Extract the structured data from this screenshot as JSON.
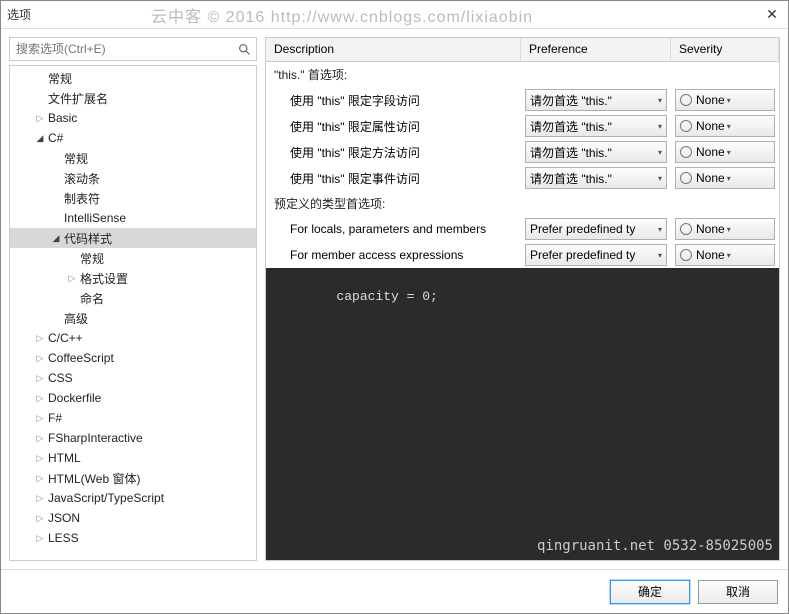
{
  "window": {
    "title": "选项"
  },
  "watermark_top": "云中客 © 2016 http://www.cnblogs.com/lixiaobin",
  "search": {
    "placeholder": "搜索选项(Ctrl+E)"
  },
  "tree": [
    {
      "label": "常规",
      "depth": 1,
      "exp": "none"
    },
    {
      "label": "文件扩展名",
      "depth": 1,
      "exp": "none"
    },
    {
      "label": "Basic",
      "depth": 1,
      "exp": "closed"
    },
    {
      "label": "C#",
      "depth": 1,
      "exp": "open"
    },
    {
      "label": "常规",
      "depth": 2,
      "exp": "none"
    },
    {
      "label": "滚动条",
      "depth": 2,
      "exp": "none"
    },
    {
      "label": "制表符",
      "depth": 2,
      "exp": "none"
    },
    {
      "label": "IntelliSense",
      "depth": 2,
      "exp": "none"
    },
    {
      "label": "代码样式",
      "depth": 2,
      "exp": "open",
      "selected": true
    },
    {
      "label": "常规",
      "depth": 3,
      "exp": "none"
    },
    {
      "label": "格式设置",
      "depth": 3,
      "exp": "closed"
    },
    {
      "label": "命名",
      "depth": 3,
      "exp": "none"
    },
    {
      "label": "高级",
      "depth": 2,
      "exp": "none"
    },
    {
      "label": "C/C++",
      "depth": 1,
      "exp": "closed"
    },
    {
      "label": "CoffeeScript",
      "depth": 1,
      "exp": "closed"
    },
    {
      "label": "CSS",
      "depth": 1,
      "exp": "closed"
    },
    {
      "label": "Dockerfile",
      "depth": 1,
      "exp": "closed"
    },
    {
      "label": "F#",
      "depth": 1,
      "exp": "closed"
    },
    {
      "label": "FSharpInteractive",
      "depth": 1,
      "exp": "closed"
    },
    {
      "label": "HTML",
      "depth": 1,
      "exp": "closed"
    },
    {
      "label": "HTML(Web 窗体)",
      "depth": 1,
      "exp": "closed"
    },
    {
      "label": "JavaScript/TypeScript",
      "depth": 1,
      "exp": "closed"
    },
    {
      "label": "JSON",
      "depth": 1,
      "exp": "closed"
    },
    {
      "label": "LESS",
      "depth": 1,
      "exp": "closed"
    }
  ],
  "grid": {
    "headers": {
      "desc": "Description",
      "pref": "Preference",
      "sev": "Severity"
    },
    "sections": [
      {
        "title": "\"this.\" 首选项:",
        "rows": [
          {
            "desc": "使用 \"this\" 限定字段访问",
            "pref": "请勿首选 \"this.\"",
            "sev": "None"
          },
          {
            "desc": "使用 \"this\" 限定属性访问",
            "pref": "请勿首选 \"this.\"",
            "sev": "None"
          },
          {
            "desc": "使用 \"this\" 限定方法访问",
            "pref": "请勿首选 \"this.\"",
            "sev": "None"
          },
          {
            "desc": "使用 \"this\" 限定事件访问",
            "pref": "请勿首选 \"this.\"",
            "sev": "None"
          }
        ]
      },
      {
        "title": "预定义的类型首选项:",
        "rows": [
          {
            "desc": "For locals, parameters and members",
            "pref": "Prefer predefined ty",
            "sev": "None"
          },
          {
            "desc": "For member access expressions",
            "pref": "Prefer predefined ty",
            "sev": "None"
          }
        ]
      }
    ]
  },
  "code_preview": "capacity = 0;",
  "watermark_code": "qingruanit.net 0532-85025005",
  "buttons": {
    "ok": "确定",
    "cancel": "取消"
  }
}
